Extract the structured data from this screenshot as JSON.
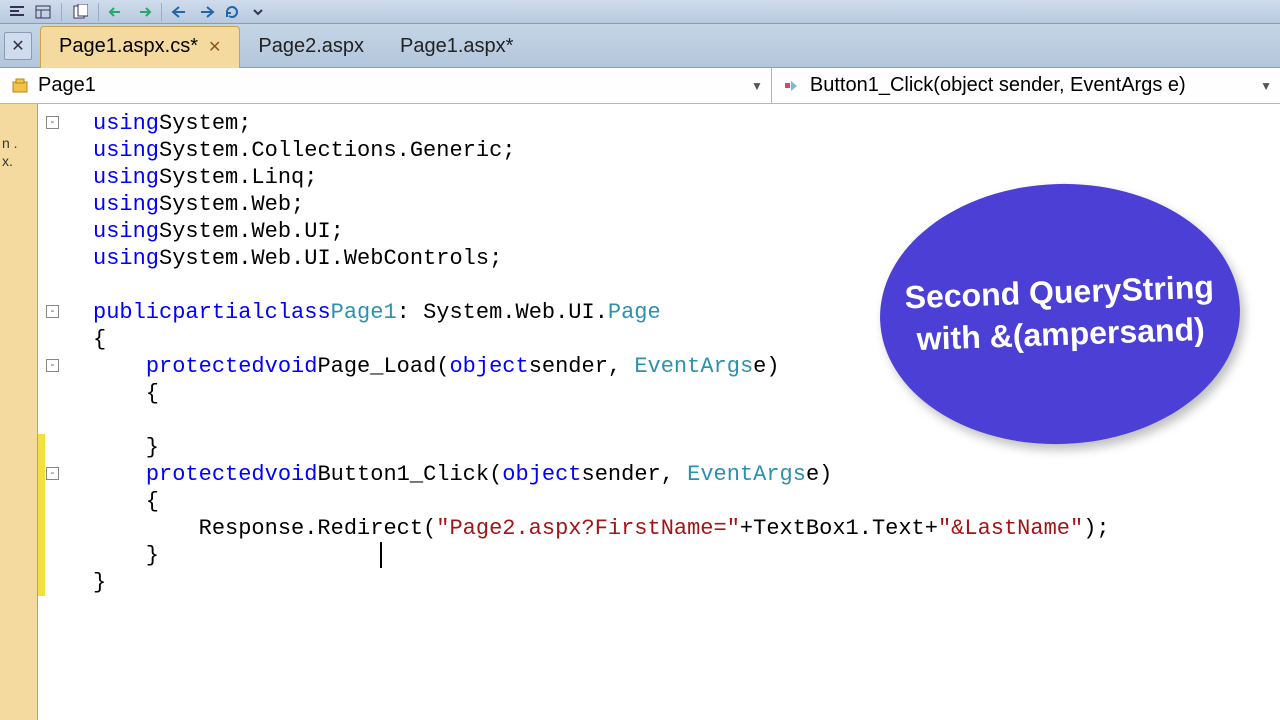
{
  "toolbar": {
    "buttons": [
      "align-left",
      "properties",
      "sep",
      "new-file",
      "sep",
      "undo",
      "redo",
      "sep",
      "nav-back",
      "nav-forward",
      "refresh",
      "more"
    ]
  },
  "tabs": [
    {
      "label": "Page1.aspx.cs*",
      "active": true,
      "closeable": true
    },
    {
      "label": "Page2.aspx",
      "active": false,
      "closeable": false
    },
    {
      "label": "Page1.aspx*",
      "active": false,
      "closeable": false
    }
  ],
  "dropdowns": {
    "class_label": "Page1",
    "method_label": "Button1_Click(object sender, EventArgs e)"
  },
  "sidebar_hint": "n\n.\nx.",
  "code": {
    "lines": [
      {
        "indent": 0,
        "tokens": [
          [
            "kw",
            "using"
          ],
          [
            " ",
            " System;"
          ]
        ]
      },
      {
        "indent": 0,
        "tokens": [
          [
            "kw",
            "using"
          ],
          [
            " ",
            " System.Collections.Generic;"
          ]
        ]
      },
      {
        "indent": 0,
        "tokens": [
          [
            "kw",
            "using"
          ],
          [
            " ",
            " System.Linq;"
          ]
        ]
      },
      {
        "indent": 0,
        "tokens": [
          [
            "kw",
            "using"
          ],
          [
            " ",
            " System.Web;"
          ]
        ]
      },
      {
        "indent": 0,
        "tokens": [
          [
            "kw",
            "using"
          ],
          [
            " ",
            " System.Web.UI;"
          ]
        ]
      },
      {
        "indent": 0,
        "tokens": [
          [
            "kw",
            "using"
          ],
          [
            " ",
            " System.Web.UI.WebControls;"
          ]
        ]
      },
      {
        "blank": true
      },
      {
        "indent": 0,
        "tokens": [
          [
            "kw",
            "public"
          ],
          [
            " ",
            " "
          ],
          [
            "kw",
            "partial"
          ],
          [
            " ",
            " "
          ],
          [
            "kw",
            "class"
          ],
          [
            " ",
            " "
          ],
          [
            "typ",
            "Page1"
          ],
          [
            " ",
            " : System.Web.UI."
          ],
          [
            "typ",
            "Page"
          ]
        ]
      },
      {
        "indent": 0,
        "tokens": [
          [
            " ",
            "{"
          ]
        ]
      },
      {
        "indent": 1,
        "tokens": [
          [
            "kw",
            "protected"
          ],
          [
            " ",
            " "
          ],
          [
            "kw",
            "void"
          ],
          [
            " ",
            " Page_Load("
          ],
          [
            "kw",
            "object"
          ],
          [
            " ",
            " sender, "
          ],
          [
            "typ",
            "EventArgs"
          ],
          [
            " ",
            " e)"
          ]
        ]
      },
      {
        "indent": 1,
        "tokens": [
          [
            " ",
            "{"
          ]
        ]
      },
      {
        "blank": true
      },
      {
        "indent": 1,
        "tokens": [
          [
            " ",
            "}"
          ]
        ]
      },
      {
        "indent": 1,
        "tokens": [
          [
            "kw",
            "protected"
          ],
          [
            " ",
            " "
          ],
          [
            "kw",
            "void"
          ],
          [
            " ",
            " Button1_Click("
          ],
          [
            "kw",
            "object"
          ],
          [
            " ",
            " sender, "
          ],
          [
            "typ",
            "EventArgs"
          ],
          [
            " ",
            " e)"
          ]
        ]
      },
      {
        "indent": 1,
        "tokens": [
          [
            " ",
            "{"
          ]
        ]
      },
      {
        "indent": 2,
        "tokens": [
          [
            " ",
            "Response.Redirect("
          ],
          [
            "str",
            "\"Page2.aspx?FirstName=\""
          ],
          [
            " ",
            "+TextBox1.Text+"
          ],
          [
            "str",
            "\"&LastName\""
          ],
          [
            " ",
            ");"
          ]
        ]
      },
      {
        "indent": 1,
        "tokens": [
          [
            " ",
            "}"
          ]
        ]
      },
      {
        "indent": 0,
        "tokens": [
          [
            " ",
            "}"
          ]
        ]
      }
    ],
    "folds": [
      0,
      7,
      9,
      13
    ],
    "change_marks": [
      [
        12,
        17
      ]
    ]
  },
  "callout_text": "Second QueryString with &(ampersand)"
}
